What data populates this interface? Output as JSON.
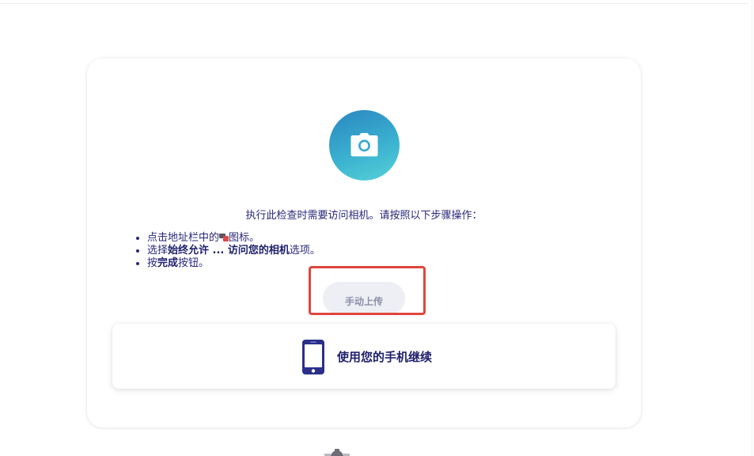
{
  "instruction": "执行此检查时需要访问相机。请按照以下步骤操作：",
  "steps": {
    "step1_prefix": "点击地址栏中的",
    "step1_suffix": "图标。",
    "step2_prefix": "选择",
    "step2_bold1": "始终允许 ... 访问您的相机",
    "step2_suffix": "选项。",
    "step3_prefix": "按",
    "step3_bold": "完成",
    "step3_suffix": "按钮。"
  },
  "upload_button_label": "手动上传",
  "phone_option_label": "使用您的手机继续",
  "colors": {
    "accent_gradient_start": "#2a86c2",
    "accent_gradient_end": "#57d2d8",
    "text_navy": "#28287a",
    "highlight_red": "#e0453f",
    "phone_icon": "#2b2f8a"
  },
  "icons": {
    "camera": "camera-icon",
    "address_bar": "camera-permission-icon",
    "phone": "smartphone-icon",
    "footer": "logo-icon"
  }
}
